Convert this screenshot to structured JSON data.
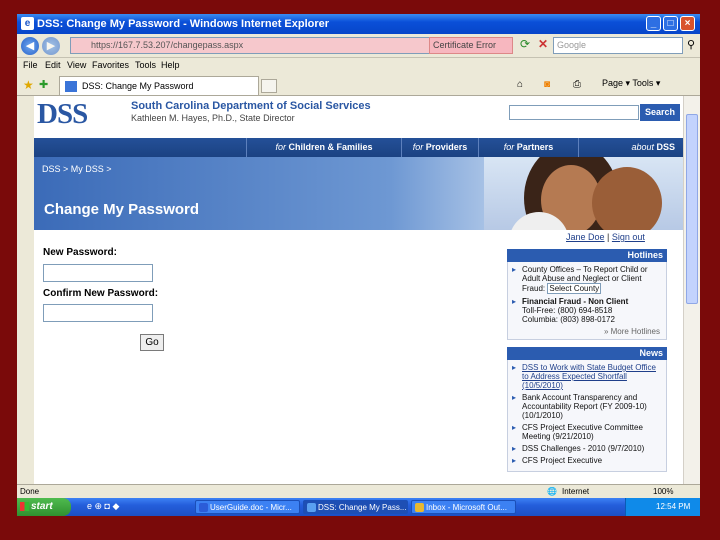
{
  "window": {
    "title": "DSS: Change My Password - Windows Internet Explorer",
    "controls": [
      "_",
      "□",
      "×"
    ]
  },
  "addressbar": {
    "url": "https://167.7.53.207/changepass.aspx",
    "cert_label": "Certificate Error",
    "search_placeholder": "Google"
  },
  "menu": [
    "File",
    "Edit",
    "View",
    "Favorites",
    "Tools",
    "Help"
  ],
  "tab": {
    "label": "DSS: Change My Password",
    "commands": "Page ▾  Tools ▾"
  },
  "site": {
    "logo": "DSS",
    "department": "South Carolina Department of Social Services",
    "director": "Kathleen M. Hayes, Ph.D., State Director",
    "search_button": "Search",
    "nav": [
      {
        "prefix": "for",
        "label": "Children & Families"
      },
      {
        "prefix": "for",
        "label": "Providers"
      },
      {
        "prefix": "for",
        "label": "Partners"
      },
      {
        "prefix": "about",
        "label": "DSS"
      }
    ],
    "breadcrumb": "DSS > My DSS >",
    "page_title": "Change My Password",
    "user_name": "Jane Doe",
    "separator": "|",
    "sign_out": "Sign out"
  },
  "form": {
    "new_password_label": "New Password:",
    "confirm_password_label": "Confirm New Password:",
    "go_button": "Go"
  },
  "hotlines": {
    "heading": "Hotlines",
    "county_text": "County Offices – To Report Child or Adult Abuse and Neglect or Client Fraud:",
    "county_select": "Select County",
    "fraud_title": "Financial Fraud - Non Client",
    "fraud_tollfree": "Toll-Free: (800) 694-8518",
    "fraud_columbia": "Columbia: (803) 898-0172",
    "more": "More Hotlines"
  },
  "news": {
    "heading": "News",
    "items": [
      "DSS to Work with State Budget Office to Address Expected Shortfall (10/5/2010)",
      "Bank Account Transparency and Accountability Report (FY 2009-10) (10/1/2010)",
      "CFS Project Executive Committee Meeting (9/21/2010)",
      "DSS Challenges - 2010 (9/7/2010)",
      "CFS Project Executive"
    ]
  },
  "status": {
    "left": "Done",
    "zone": "Internet",
    "zoom": "100%"
  },
  "taskbar": {
    "start": "start",
    "items": [
      {
        "label": "UserGuide.doc - Micr...",
        "color": "#2b5cd8"
      },
      {
        "label": "DSS: Change My Pass...",
        "color": "#5aa0f0"
      },
      {
        "label": "Inbox - Microsoft Out...",
        "color": "#e8b830"
      }
    ],
    "clock": "12:54 PM"
  }
}
